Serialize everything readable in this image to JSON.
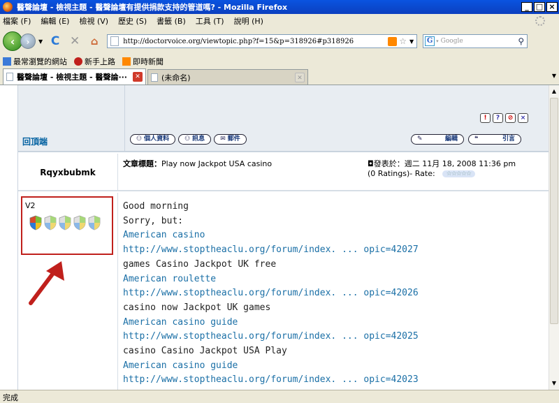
{
  "window": {
    "title": "醫聲論壇 - 檢視主題 - 醫聲論壇有提供捐款支持的管道嗎? - Mozilla Firefox",
    "controls": [
      "_",
      "□",
      "×"
    ]
  },
  "menu": [
    "檔案 (F)",
    "編輯 (E)",
    "檢視 (V)",
    "歷史 (S)",
    "書籤 (B)",
    "工具 (T)",
    "說明 (H)"
  ],
  "nav": {
    "url": "http://doctorvoice.org/viewtopic.php?f=15&p=318926#p318926",
    "search_placeholder": "Google"
  },
  "bookmarks": [
    "最常瀏覽的網站",
    "新手上路",
    "即時新聞"
  ],
  "tabs": [
    {
      "label": "醫聲論壇 - 檢視主題 - 醫聲論···",
      "active": true
    },
    {
      "label": "(未命名)",
      "active": false
    }
  ],
  "forum": {
    "top_link": "回頂端",
    "profile_buttons": [
      "個人資料",
      "訊息",
      "郵件"
    ],
    "post_buttons": [
      "編輯",
      "引言"
    ],
    "tool_icons": [
      "!",
      "?",
      "⊘",
      "×"
    ],
    "username": "Rqyxbubmk",
    "subject_label": "文章標題：",
    "subject": "Play now Jackpot USA casino",
    "posted": "◘發表於：週二 11月 18, 2008 11:36 pm",
    "rating": "(0 Ratings)- Rate:",
    "rating_stars": "☆☆☆☆☆",
    "rank": "V2",
    "post_lines": [
      {
        "text": "Good morning",
        "type": "plain"
      },
      {
        "text": "Sorry, but:",
        "type": "plain"
      },
      {
        "text": "American casino",
        "type": "link"
      },
      {
        "text": "http://www.stoptheaclu.org/forum/index. ... opic=42027",
        "type": "link"
      },
      {
        "text": "games Casino Jackpot UK free",
        "type": "plain"
      },
      {
        "text": "American roulette",
        "type": "link"
      },
      {
        "text": "http://www.stoptheaclu.org/forum/index. ... opic=42026",
        "type": "link"
      },
      {
        "text": "casino now Jackpot UK games",
        "type": "plain"
      },
      {
        "text": "American casino guide",
        "type": "link"
      },
      {
        "text": "http://www.stoptheaclu.org/forum/index. ... opic=42025",
        "type": "link"
      },
      {
        "text": "casino Casino Jackpot USA Play",
        "type": "plain"
      },
      {
        "text": "American casino guide",
        "type": "link"
      },
      {
        "text": "http://www.stoptheaclu.org/forum/index. ... opic=42023",
        "type": "link"
      }
    ]
  },
  "status": "完成",
  "colors": {
    "link": "#1a6fa6",
    "highlight_border": "#c0201c",
    "title_bar": "#0a54e0"
  }
}
